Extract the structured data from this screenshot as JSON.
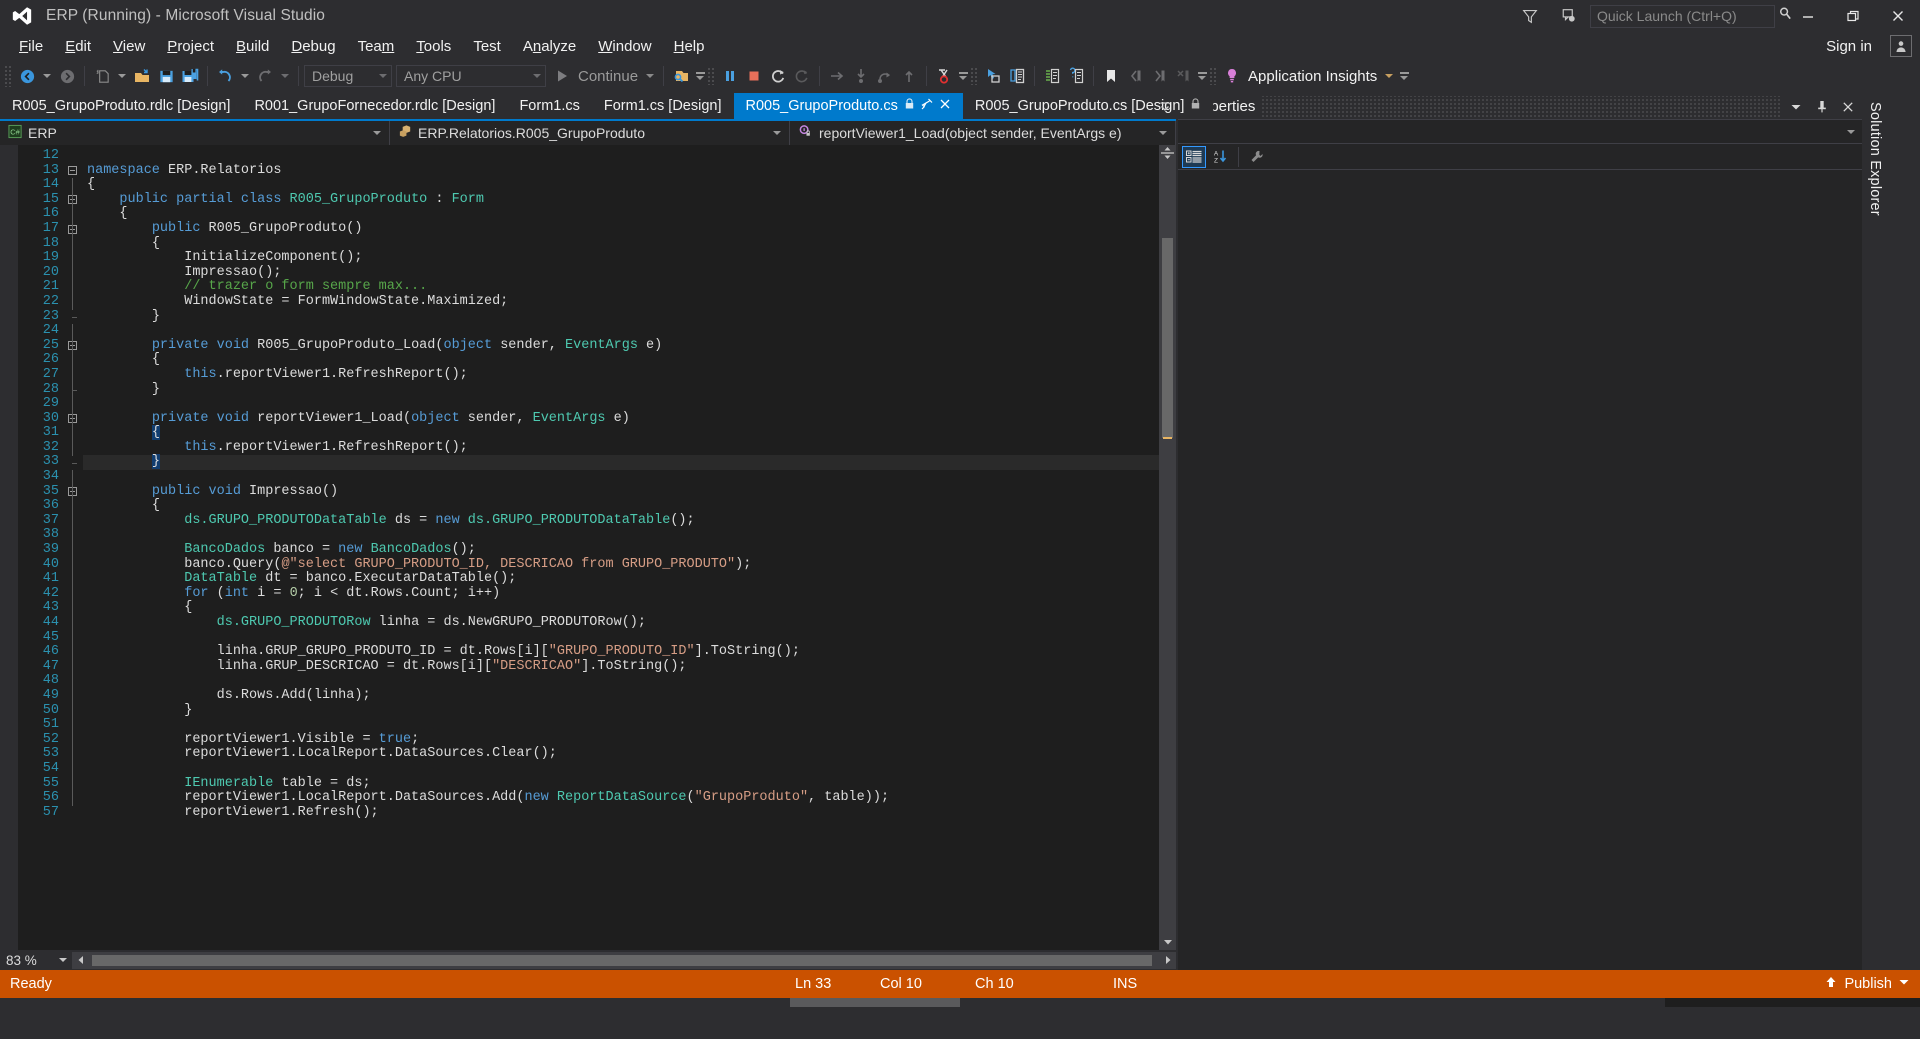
{
  "window": {
    "title": "ERP (Running) - Microsoft Visual Studio",
    "logo_icon": "visual-studio-logo",
    "minimize_icon": "minimize-icon",
    "maximize_icon": "restore-icon",
    "close_icon": "close-icon",
    "feedback_icon": "feedback-icon",
    "filter_icon": "funnel-icon"
  },
  "quick_launch": {
    "placeholder": "Quick Launch (Ctrl+Q)",
    "value": "",
    "search_icon": "magnifier-icon"
  },
  "account": {
    "sign_in_label": "Sign in",
    "avatar_icon": "user-avatar-icon"
  },
  "menu": {
    "items": [
      {
        "label": "File",
        "accel": "F"
      },
      {
        "label": "Edit",
        "accel": "E"
      },
      {
        "label": "View",
        "accel": "V"
      },
      {
        "label": "Project",
        "accel": "P"
      },
      {
        "label": "Build",
        "accel": "B"
      },
      {
        "label": "Debug",
        "accel": "D"
      },
      {
        "label": "Team",
        "accel": "m"
      },
      {
        "label": "Tools",
        "accel": "T"
      },
      {
        "label": "Test",
        "accel": ""
      },
      {
        "label": "Analyze",
        "accel": "n"
      },
      {
        "label": "Window",
        "accel": "W"
      },
      {
        "label": "Help",
        "accel": "H"
      }
    ]
  },
  "toolbar": {
    "navigate_back_icon": "navigate-back-icon",
    "navigate_forward_icon": "navigate-forward-icon",
    "new_item_icon": "new-item-icon",
    "open_file_icon": "open-file-icon",
    "save_icon": "save-icon",
    "save_all_icon": "save-all-icon",
    "undo_icon": "undo-icon",
    "redo_icon": "redo-icon",
    "config_value": "Debug",
    "platform_value": "Any CPU",
    "continue_label": "Continue",
    "continue_icon": "play-icon",
    "attach_icon": "attach-to-process-icon",
    "break_all_icon": "pause-icon",
    "stop_debugging_icon": "stop-icon",
    "restart_icon": "restart-icon",
    "restart_alt_icon": "restart-alt-icon",
    "show_next_statement_icon": "show-next-statement-icon",
    "step_into_icon": "step-into-icon",
    "step_over_icon": "step-over-icon",
    "step_out_icon": "step-out-icon",
    "breakpoint_icon": "breakpoint-icon",
    "pointer_window_icon": "pointer-window-icon",
    "compare_icon": "compare-icon",
    "indent_icon": "comment-icon",
    "uncomment_icon": "uncomment-icon",
    "bookmark_icon": "bookmark-icon",
    "prev_bookmark_icon": "previous-bookmark-icon",
    "next_bookmark_icon": "next-bookmark-icon",
    "clear_bookmarks_icon": "clear-bookmarks-icon",
    "app_insights_label": "Application Insights",
    "app_insights_icon": "lightbulb-icon",
    "overflow_icon": "toolbar-overflow-icon"
  },
  "tabs": {
    "items": [
      {
        "label": "R005_GrupoProduto.rdlc [Design]",
        "active": false,
        "locked": false
      },
      {
        "label": "R001_GrupoFornecedor.rdlc [Design]",
        "active": false,
        "locked": false
      },
      {
        "label": "Form1.cs",
        "active": false,
        "locked": false
      },
      {
        "label": "Form1.cs [Design]",
        "active": false,
        "locked": false
      },
      {
        "label": "R005_GrupoProduto.cs",
        "active": true,
        "locked": true
      },
      {
        "label": "R005_GrupoProduto.cs [Design]",
        "active": false,
        "locked": true
      }
    ],
    "pin_icon": "pin-icon",
    "close_icon": "close-tab-icon",
    "lock_icon": "lock-icon",
    "overflow_icon": "tab-overflow-icon"
  },
  "navbar": {
    "project": "ERP",
    "project_icon": "csharp-project-icon",
    "type": "ERP.Relatorios.R005_GrupoProduto",
    "type_icon": "class-icon",
    "member": "reportViewer1_Load(object sender, EventArgs e)",
    "member_icon": "method-icon"
  },
  "editor": {
    "first_line": 12,
    "current_line": 33,
    "zoom_level": "83 %",
    "lines": [
      {
        "n": 12,
        "tokens": []
      },
      {
        "n": 13,
        "fold": "collapse",
        "tokens": [
          {
            "t": "namespace ",
            "c": "kw"
          },
          {
            "t": "ERP.Relatorios",
            "c": "pln"
          }
        ]
      },
      {
        "n": 14,
        "indent": 0,
        "tokens": [
          {
            "t": "{",
            "c": "pln"
          }
        ]
      },
      {
        "n": 15,
        "fold": "collapse",
        "indent": 4,
        "tokens": [
          {
            "t": "public partial class ",
            "c": "kw"
          },
          {
            "t": "R005_GrupoProduto ",
            "c": "typ"
          },
          {
            "t": ": ",
            "c": "pln"
          },
          {
            "t": "Form",
            "c": "typ"
          }
        ]
      },
      {
        "n": 16,
        "indent": 4,
        "tokens": [
          {
            "t": "{",
            "c": "pln"
          }
        ]
      },
      {
        "n": 17,
        "fold": "collapse",
        "indent": 8,
        "tokens": [
          {
            "t": "public ",
            "c": "kw"
          },
          {
            "t": "R005_GrupoProduto",
            "c": "pln"
          },
          {
            "t": "()",
            "c": "pln"
          }
        ]
      },
      {
        "n": 18,
        "indent": 8,
        "tokens": [
          {
            "t": "{",
            "c": "pln"
          }
        ]
      },
      {
        "n": 19,
        "indent": 12,
        "tokens": [
          {
            "t": "InitializeComponent();",
            "c": "pln"
          }
        ]
      },
      {
        "n": 20,
        "indent": 12,
        "tokens": [
          {
            "t": "Impressao();",
            "c": "pln"
          }
        ]
      },
      {
        "n": 21,
        "indent": 12,
        "tokens": [
          {
            "t": "// trazer o form sempre max...",
            "c": "cmt"
          }
        ]
      },
      {
        "n": 22,
        "indent": 12,
        "tokens": [
          {
            "t": "WindowState = FormWindowState.Maximized;",
            "c": "pln"
          }
        ]
      },
      {
        "n": 23,
        "indent": 8,
        "tokens": [
          {
            "t": "}",
            "c": "pln"
          }
        ]
      },
      {
        "n": 24,
        "tokens": []
      },
      {
        "n": 25,
        "fold": "collapse",
        "indent": 8,
        "tokens": [
          {
            "t": "private void ",
            "c": "kw"
          },
          {
            "t": "R005_GrupoProduto_Load",
            "c": "pln"
          },
          {
            "t": "(",
            "c": "pln"
          },
          {
            "t": "object",
            "c": "kw"
          },
          {
            "t": " sender, ",
            "c": "pln"
          },
          {
            "t": "EventArgs",
            "c": "typ"
          },
          {
            "t": " e)",
            "c": "pln"
          }
        ]
      },
      {
        "n": 26,
        "indent": 8,
        "tokens": [
          {
            "t": "{",
            "c": "pln"
          }
        ]
      },
      {
        "n": 27,
        "indent": 12,
        "tokens": [
          {
            "t": "this",
            "c": "kw"
          },
          {
            "t": ".reportViewer1.RefreshReport();",
            "c": "pln"
          }
        ]
      },
      {
        "n": 28,
        "indent": 8,
        "tokens": [
          {
            "t": "}",
            "c": "pln"
          }
        ]
      },
      {
        "n": 29,
        "tokens": []
      },
      {
        "n": 30,
        "fold": "collapse",
        "indent": 8,
        "tokens": [
          {
            "t": "private void ",
            "c": "kw"
          },
          {
            "t": "reportViewer1_Load",
            "c": "pln"
          },
          {
            "t": "(",
            "c": "pln"
          },
          {
            "t": "object",
            "c": "kw"
          },
          {
            "t": " sender, ",
            "c": "pln"
          },
          {
            "t": "EventArgs",
            "c": "typ"
          },
          {
            "t": " e)",
            "c": "pln"
          }
        ]
      },
      {
        "n": 31,
        "indent": 8,
        "tokens": [
          {
            "t": "{",
            "c": "pln",
            "hl": true
          }
        ]
      },
      {
        "n": 32,
        "indent": 12,
        "tokens": [
          {
            "t": "this",
            "c": "kw"
          },
          {
            "t": ".reportViewer1.RefreshReport();",
            "c": "pln"
          }
        ]
      },
      {
        "n": 33,
        "indent": 8,
        "current": true,
        "tokens": [
          {
            "t": "}",
            "c": "pln",
            "hl": true
          }
        ]
      },
      {
        "n": 34,
        "tokens": []
      },
      {
        "n": 35,
        "fold": "collapse",
        "indent": 8,
        "tokens": [
          {
            "t": "public void ",
            "c": "kw"
          },
          {
            "t": "Impressao()",
            "c": "pln"
          }
        ]
      },
      {
        "n": 36,
        "indent": 8,
        "tokens": [
          {
            "t": "{",
            "c": "pln"
          }
        ]
      },
      {
        "n": 37,
        "indent": 12,
        "tokens": [
          {
            "t": "ds.GRUPO_PRODUTODataTable",
            "c": "typ"
          },
          {
            "t": " ds = ",
            "c": "pln"
          },
          {
            "t": "new ",
            "c": "kw"
          },
          {
            "t": "ds.GRUPO_PRODUTODataTable",
            "c": "typ"
          },
          {
            "t": "();",
            "c": "pln"
          }
        ]
      },
      {
        "n": 38,
        "tokens": []
      },
      {
        "n": 39,
        "indent": 12,
        "tokens": [
          {
            "t": "BancoDados",
            "c": "typ"
          },
          {
            "t": " banco = ",
            "c": "pln"
          },
          {
            "t": "new ",
            "c": "kw"
          },
          {
            "t": "BancoDados",
            "c": "typ"
          },
          {
            "t": "();",
            "c": "pln"
          }
        ]
      },
      {
        "n": 40,
        "indent": 12,
        "tokens": [
          {
            "t": "banco.Query(",
            "c": "pln"
          },
          {
            "t": "@\"select GRUPO_PRODUTO_ID, DESCRICAO from GRUPO_PRODUTO\"",
            "c": "str"
          },
          {
            "t": ");",
            "c": "pln"
          }
        ]
      },
      {
        "n": 41,
        "indent": 12,
        "tokens": [
          {
            "t": "DataTable",
            "c": "typ"
          },
          {
            "t": " dt = banco.ExecutarDataTable();",
            "c": "pln"
          }
        ]
      },
      {
        "n": 42,
        "indent": 12,
        "tokens": [
          {
            "t": "for ",
            "c": "kw"
          },
          {
            "t": "(",
            "c": "pln"
          },
          {
            "t": "int",
            "c": "kw"
          },
          {
            "t": " i = ",
            "c": "pln"
          },
          {
            "t": "0",
            "c": "num"
          },
          {
            "t": "; i < dt.Rows.Count; i++)",
            "c": "pln"
          }
        ]
      },
      {
        "n": 43,
        "indent": 12,
        "tokens": [
          {
            "t": "{",
            "c": "pln"
          }
        ]
      },
      {
        "n": 44,
        "indent": 16,
        "tokens": [
          {
            "t": "ds.GRUPO_PRODUTORow",
            "c": "typ"
          },
          {
            "t": " linha = ds.NewGRUPO_PRODUTORow();",
            "c": "pln"
          }
        ]
      },
      {
        "n": 45,
        "tokens": []
      },
      {
        "n": 46,
        "indent": 16,
        "tokens": [
          {
            "t": "linha.GRUP_GRUPO_PRODUTO_ID = dt.Rows[i][",
            "c": "pln"
          },
          {
            "t": "\"GRUPO_PRODUTO_ID\"",
            "c": "str"
          },
          {
            "t": "].ToString();",
            "c": "pln"
          }
        ]
      },
      {
        "n": 47,
        "indent": 16,
        "tokens": [
          {
            "t": "linha.GRUP_DESCRICAO = dt.Rows[i][",
            "c": "pln"
          },
          {
            "t": "\"DESCRICAO\"",
            "c": "str"
          },
          {
            "t": "].ToString();",
            "c": "pln"
          }
        ]
      },
      {
        "n": 48,
        "tokens": []
      },
      {
        "n": 49,
        "indent": 16,
        "tokens": [
          {
            "t": "ds.Rows.Add(linha);",
            "c": "pln"
          }
        ]
      },
      {
        "n": 50,
        "indent": 12,
        "tokens": [
          {
            "t": "}",
            "c": "pln"
          }
        ]
      },
      {
        "n": 51,
        "tokens": []
      },
      {
        "n": 52,
        "indent": 12,
        "tokens": [
          {
            "t": "reportViewer1.Visible = ",
            "c": "pln"
          },
          {
            "t": "true",
            "c": "kw"
          },
          {
            "t": ";",
            "c": "pln"
          }
        ]
      },
      {
        "n": 53,
        "indent": 12,
        "tokens": [
          {
            "t": "reportViewer1.LocalReport.DataSources.Clear();",
            "c": "pln"
          }
        ]
      },
      {
        "n": 54,
        "tokens": []
      },
      {
        "n": 55,
        "indent": 12,
        "tokens": [
          {
            "t": "IEnumerable",
            "c": "typ"
          },
          {
            "t": " table = ds;",
            "c": "pln"
          }
        ]
      },
      {
        "n": 56,
        "indent": 12,
        "tokens": [
          {
            "t": "reportViewer1.LocalReport.DataSources.Add(",
            "c": "pln"
          },
          {
            "t": "new ",
            "c": "kw"
          },
          {
            "t": "ReportDataSource",
            "c": "typ"
          },
          {
            "t": "(",
            "c": "pln"
          },
          {
            "t": "\"GrupoProduto\"",
            "c": "str"
          },
          {
            "t": ", table));",
            "c": "pln"
          }
        ]
      },
      {
        "n": 57,
        "indent": 12,
        "tokens": [
          {
            "t": "reportViewer1.Refresh();",
            "c": "pln"
          }
        ]
      }
    ]
  },
  "properties_pane": {
    "title": "Properties",
    "object_value": "",
    "categorized_icon": "categorized-view-icon",
    "alphabetical_icon": "alphabetical-sort-icon",
    "properties_icon": "property-pages-icon",
    "dropdown_icon": "chevron-down-icon",
    "pin_icon": "pin-icon",
    "close_icon": "close-icon"
  },
  "solution_explorer": {
    "label": "Solution Explorer"
  },
  "statusbar": {
    "ready": "Ready",
    "line": "Ln 33",
    "column": "Col 10",
    "character": "Ch 10",
    "insert_mode": "INS",
    "publish_label": "Publish",
    "publish_icon": "publish-arrow-icon"
  },
  "colors": {
    "accent": "#007acc",
    "status_bar": "#ca5100",
    "chrome": "#2d2d30",
    "editor_bg": "#1e1e1e",
    "line_number": "#2b91af",
    "keyword": "#569cd6",
    "type": "#4ec9b0",
    "string": "#d69d85",
    "comment": "#57a64a",
    "number": "#b5cea8"
  }
}
